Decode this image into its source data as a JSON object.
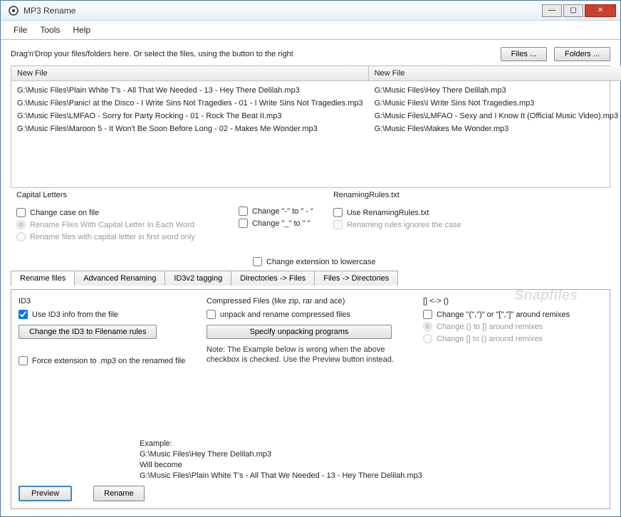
{
  "title": "MP3 Rename",
  "menu": {
    "file": "File",
    "tools": "Tools",
    "help": "Help"
  },
  "toprow": {
    "hint": "Drag'n'Drop your files/folders here. Or select the files, using the button to the right",
    "files_btn": "Files ...",
    "folders_btn": "Folders ..."
  },
  "cols": {
    "left": "New File",
    "right": "New File"
  },
  "files_left": [
    "G:\\Music Files\\Plain White T's - All That We Needed - 13 - Hey There Delilah.mp3",
    "G:\\Music Files\\Panic! at the Disco - I Write Sins Not Tragedies - 01 - I Write Sins Not Tragedies.mp3",
    "G:\\Music Files\\LMFAO - Sorry for Party Rocking - 01 - Rock The Beat II.mp3",
    "G:\\Music Files\\Maroon 5 - It Won't Be Soon Before Long - 02 - Makes Me Wonder.mp3"
  ],
  "files_right": [
    "G:\\Music Files\\Hey There Delilah.mp3",
    "G:\\Music Files\\I Write Sins Not Tragedies.mp3",
    "G:\\Music Files\\LMFAO - Sexy and I Know It (Official Music Video).mp3",
    "G:\\Music Files\\Makes Me Wonder.mp3"
  ],
  "cap": {
    "title": "Capital Letters",
    "change_case": "Change case on file",
    "r1": "Rename Files With Capital Letter In Each Word",
    "r2": "Rename files with capital letter in first word only"
  },
  "chg": {
    "dash": "Change \"-\" to \" - \"",
    "under": "Change \"_\" to \" \"",
    "ext": "Change extension to lowercase"
  },
  "renrules": {
    "title": "RenamingRules.txt",
    "use": "Use RenamingRules.txt",
    "ignore": "Renaming rules ignores the case"
  },
  "tabs": {
    "t1": "Rename files",
    "t2": "Advanced Renaming",
    "t3": "ID3v2 tagging",
    "t4": "Directories -> Files",
    "t5": "Files -> Directories"
  },
  "id3": {
    "title": "ID3",
    "use": "Use ID3 info from the file",
    "btn": "Change the ID3 to Filename rules",
    "force": "Force extension to .mp3 on the renamed file"
  },
  "comp": {
    "title": "Compressed Files (like zip, rar and ace)",
    "unpack": "unpack and rename compressed files",
    "btn": "Specify unpacking programs",
    "note": "Note: The Example below is wrong when the above checkbox is checked. Use the Preview button instead."
  },
  "remix": {
    "title": "[] <-> ()",
    "chg": "Change \"(\",\")\" or \"[\",\"]\" around remixes",
    "r1": "Change () to [] around remixes",
    "r2": "Change [] to () around remixes"
  },
  "example": {
    "l1": "Example:",
    "l2": "G:\\Music Files\\Hey There Delilah.mp3",
    "l3": "Will become",
    "l4": "G:\\Music Files\\Plain White T's - All That We Needed - 13 - Hey There Delilah.mp3"
  },
  "bottom": {
    "preview": "Preview",
    "rename": "Rename"
  },
  "watermark": "Snapfiles"
}
